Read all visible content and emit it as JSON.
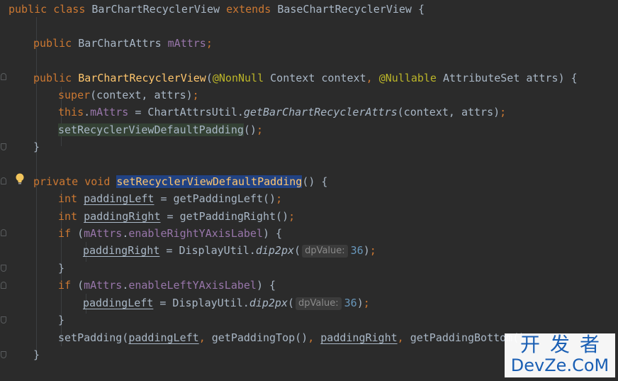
{
  "code": {
    "line1": {
      "kw_public": "public",
      "kw_class": "class",
      "class_name": "BarChartRecyclerView",
      "kw_extends": "extends",
      "super_class": "BaseChartRecyclerView",
      "brace": "{"
    },
    "line2": {
      "kw_public": "public",
      "type": "BarChartAttrs",
      "field": "mAttrs",
      "semi": ";"
    },
    "line3": {
      "kw_public": "public",
      "ctor": "BarChartRecyclerView",
      "open": "(",
      "ann_nonnull": "@NonNull",
      "param1": " Context context",
      "comma": ",",
      "ann_nullable": "@Nullable",
      "param2": " AttributeSet attrs",
      "close": ") {"
    },
    "line4": {
      "kw_super": "super",
      "args": "(context, attrs)",
      "semi": ";"
    },
    "line5": {
      "kw_this": "this",
      "dot": ".",
      "field": "mAttrs",
      "assign": " = ChartAttrsUtil.",
      "method": "getBarChartRecyclerAttrs",
      "args": "(context, attrs)",
      "semi": ";"
    },
    "line6": {
      "call": "setRecyclerViewDefaultPadding",
      "parens": "()",
      "semi": ";"
    },
    "line7": {
      "brace": "}"
    },
    "line8": {
      "kw_private": "private",
      "kw_void": "void",
      "method": "setRecyclerViewDefaultPadding",
      "rest": "() {"
    },
    "line9": {
      "kw_int": "int",
      "var": "paddingLeft",
      "rest": " = getPaddingLeft()",
      "semi": ";"
    },
    "line10": {
      "kw_int": "int",
      "var": "paddingRight",
      "rest": " = getPaddingRight()",
      "semi": ";"
    },
    "line11": {
      "kw_if": "if",
      "open": " (",
      "field": "mAttrs",
      "dot": ".",
      "field2": "enableRightYAxisLabel",
      "close": ") {"
    },
    "line12": {
      "var": "paddingRight",
      "assign": " = DisplayUtil.",
      "method": "dip2px",
      "open": "(",
      "hint": "dpValue:",
      "num": "36",
      "close": ")",
      "semi": ";"
    },
    "line13": {
      "brace": "}"
    },
    "line14": {
      "kw_if": "if",
      "open": " (",
      "field": "mAttrs",
      "dot": ".",
      "field2": "enableLeftYAxisLabel",
      "close": ") {"
    },
    "line15": {
      "var": "paddingLeft",
      "assign": " = DisplayUtil.",
      "method": "dip2px",
      "open": "(",
      "hint": "dpValue:",
      "num": "36",
      "close": ")",
      "semi": ";"
    },
    "line16": {
      "brace": "}"
    },
    "line17": {
      "call": "setPadding(",
      "var1": "paddingLeft",
      "comma1": ",",
      "mid": " getPaddingTop()",
      "comma2": ",",
      "sp": " ",
      "var2": "paddingRight",
      "comma3": ",",
      "end": " getPaddingBottom()"
    },
    "line18": {
      "brace": "}"
    }
  },
  "watermark": {
    "cn": "开发者",
    "en": "DevZe.CoM"
  },
  "icons": {
    "fold": "fold-marker-icon",
    "bulb": "lightbulb-icon"
  },
  "colors": {
    "background": "#2b2b2b",
    "keyword": "#cc7832",
    "field": "#9876aa",
    "function": "#ffc66d",
    "annotation": "#bbb529",
    "number": "#6897bb",
    "text": "#a9b7c6"
  }
}
